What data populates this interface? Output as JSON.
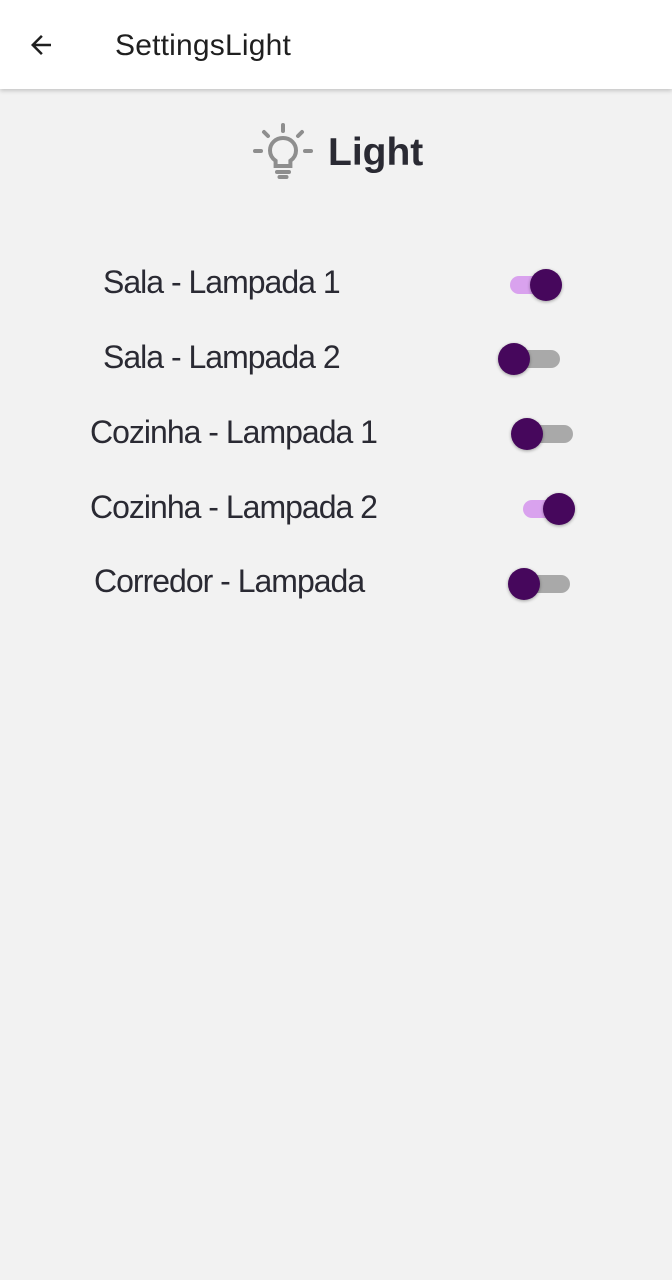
{
  "appbar": {
    "title": "SettingsLight",
    "back_icon": "arrow-back-icon"
  },
  "header": {
    "icon": "lightbulb-icon",
    "title": "Light"
  },
  "colors": {
    "switch_thumb": "#46075c",
    "switch_track_on": "#d9a2ee",
    "switch_track_off": "#a9a9a9",
    "background": "#f2f2f2"
  },
  "lights": [
    {
      "label": "Sala - Lampada 1",
      "on": true
    },
    {
      "label": "Sala - Lampada 2",
      "on": false
    },
    {
      "label": "Cozinha - Lampada 1",
      "on": false
    },
    {
      "label": "Cozinha - Lampada 2",
      "on": true
    },
    {
      "label": "Corredor - Lampada",
      "on": false
    }
  ]
}
